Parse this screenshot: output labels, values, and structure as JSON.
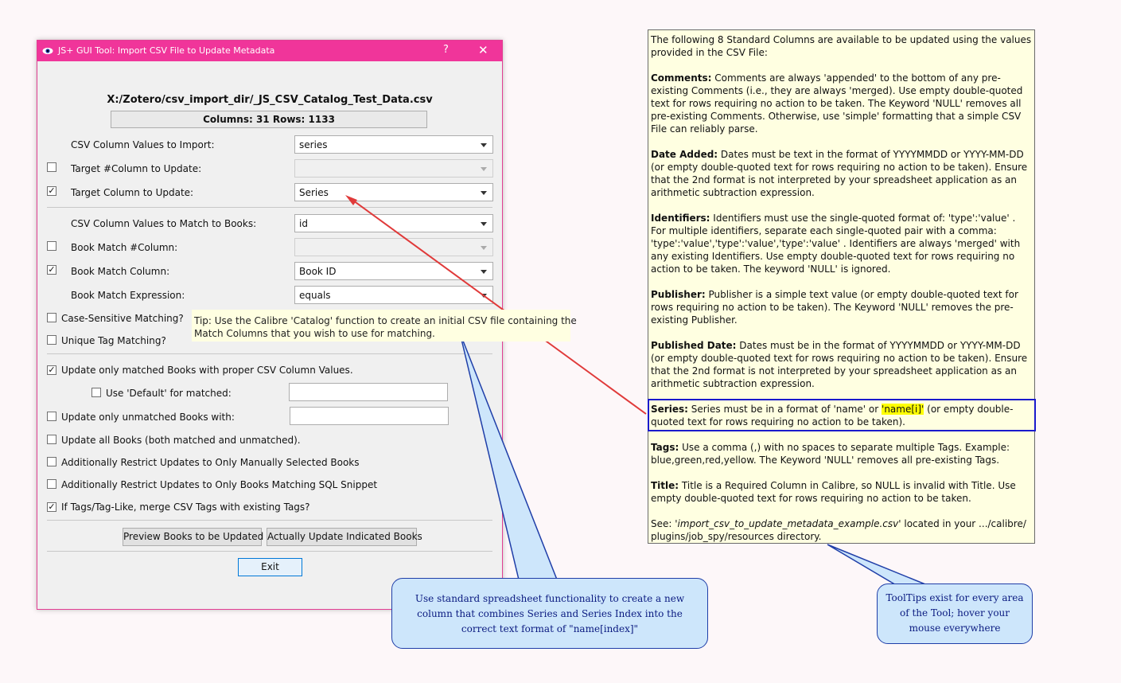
{
  "window": {
    "title": "JS+ GUI Tool:  Import CSV File to Update Metadata",
    "help_label": "?",
    "close_label": "✕"
  },
  "file": {
    "path": "X:/Zotero/csv_import_dir/_JS_CSV_Catalog_Test_Data.csv",
    "summary": "Columns: 31  Rows: 1133"
  },
  "form": {
    "import_values_label": "CSV Column Values to Import:",
    "import_values_selected": "series",
    "target_hash_label": "Target #Column to Update:",
    "target_hash_selected": "",
    "target_col_label": "Target Column to Update:",
    "target_col_selected": "Series",
    "match_values_label": "CSV Column Values to Match to Books:",
    "match_values_selected": "id",
    "book_match_hash_label": "Book Match #Column:",
    "book_match_hash_selected": "",
    "book_match_col_label": "Book Match Column:",
    "book_match_col_selected": "Book ID",
    "book_match_expr_label": "Book Match Expression:",
    "book_match_expr_selected": "equals",
    "case_sensitive_label": "Case-Sensitive Matching?",
    "unique_tag_label": "Unique Tag Matching?",
    "update_matched_label": "Update only matched Books with proper CSV Column Values.",
    "use_default_label": "Use 'Default' for matched:",
    "use_default_value": "",
    "update_unmatched_label": "Update only unmatched Books with:",
    "update_unmatched_value": "",
    "update_all_label": "Update all Books (both matched and unmatched).",
    "restrict_manual_label": "Additionally Restrict Updates to Only Manually Selected Books",
    "restrict_sql_label": "Additionally Restrict Updates to Only Books Matching SQL Snippet",
    "merge_tags_label": "If Tags/Tag-Like, merge CSV Tags with existing Tags?",
    "check_mark": "✓"
  },
  "buttons": {
    "preview": "Preview Books to be Updated",
    "update": "Actually Update Indicated Books",
    "exit": "Exit"
  },
  "tooltip": {
    "line1": "Tip: Use the Calibre 'Catalog' function to create an initial CSV file containing the",
    "line2": "Match Columns that you wish to use for matching."
  },
  "help": {
    "intro": "The following 8 Standard Columns are available to be updated using the values provided in the CSV File:",
    "comments_h": "Comments:",
    "comments_t": " Comments are always 'appended' to the bottom of any pre-existing Comments (i.e., they are always 'merged). Use empty double-quoted text for rows requiring no action to be taken. The Keyword 'NULL' removes all pre-existing Comments. Otherwise, use 'simple' formatting that a simple CSV File can reliably parse.",
    "date_h": "Date Added:",
    "date_t": " Dates must be text in the format of YYYYMMDD or YYYY-MM-DD (or empty double-quoted text for rows requiring no action to be taken). Ensure that the 2nd format is not interpreted by your spreadsheet application as an arithmetic subtraction expression.",
    "ident_h": "Identifiers:",
    "ident_t": " Identifiers must use the single-quoted format of: 'type':'value' . For multiple identifiers, separate each single-quoted pair with a comma: 'type':'value','type':'value','type':'value' . Identifiers are always 'merged' with any existing Identifiers. Use empty double-quoted text for rows requiring no action to be taken. The keyword 'NULL' is ignored.",
    "pub_h": "Publisher:",
    "pub_t": " Publisher is a simple text value (or empty double-quoted text for rows requiring no action to be taken). The Keyword 'NULL' removes the pre-existing Publisher.",
    "pubdate_h": "Published Date:",
    "pubdate_t": " Dates must be in the format of YYYYMMDD or YYYY-MM-DD (or empty double-quoted text for rows requiring no action to be taken). Ensure that the 2nd format is not interpreted by your spreadsheet application as an arithmetic subtraction expression.",
    "series_h": "Series:",
    "series_t1": " Series must be in a format of 'name' or ",
    "series_hl": "'name[i]'",
    "series_t2": " (or empty double-quoted text for rows requiring no action to be taken).",
    "tags_h": "Tags:",
    "tags_t": " Use a comma (,) with no spaces to separate multiple Tags. Example: blue,green,red,yellow. The Keyword 'NULL' removes all pre-existing Tags.",
    "title_h": "Title:",
    "title_t": " Title is a Required Column in Calibre, so NULL is invalid with Title. Use empty double-quoted text for rows requiring no action to be taken.",
    "see_pre": "See:  ",
    "see_file": "'import_csv_to_update_metadata_example.csv'",
    "see_post": " located in your .../calibre/ plugins/job_spy/resources directory."
  },
  "callouts": {
    "spreadsheet_1": "Use standard spreadsheet functionality to create a new",
    "spreadsheet_2": "column that combines Series and Series Index into the",
    "spreadsheet_3": "correct text format of \"name[index]\"",
    "tooltips_1": "ToolTips exist for every area",
    "tooltips_2": "of the Tool; hover your",
    "tooltips_3": "mouse everywhere"
  },
  "colors": {
    "titlebar": "#f0359a",
    "tooltip_bg": "#ffffe1",
    "callout_bg": "#cde6fb",
    "highlight": "#ffff00",
    "arrow": "#e03a3a"
  }
}
